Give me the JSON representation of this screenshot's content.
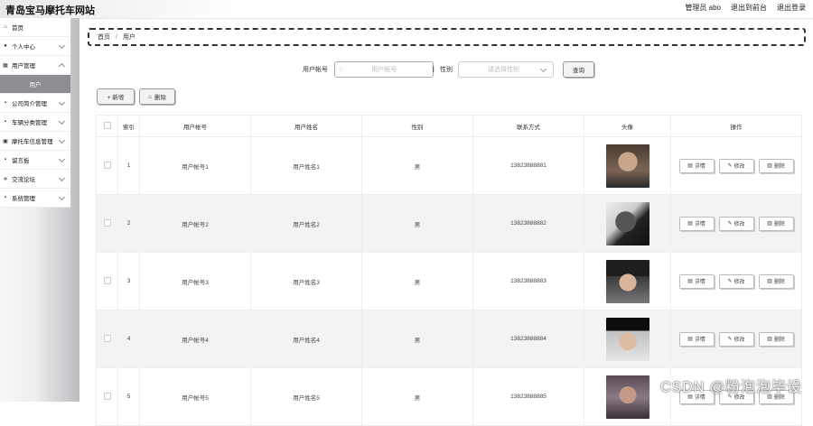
{
  "brand": "青岛宝马摩托车网站",
  "top_links": {
    "user": "管理员 abo",
    "front": "退出到前台",
    "logout": "退出登录"
  },
  "sidebar": {
    "items": [
      {
        "label": "首页",
        "icon": "home-icon"
      },
      {
        "label": "个人中心",
        "icon": "person-icon"
      },
      {
        "label": "用户管理",
        "icon": "grid-icon"
      },
      {
        "label": "用户",
        "icon": ""
      },
      {
        "label": "公司简介管理",
        "icon": "grid-icon"
      },
      {
        "label": "车辆分类管理",
        "icon": "grid-icon"
      },
      {
        "label": "摩托车信息管理",
        "icon": "archive-icon"
      },
      {
        "label": "留言板",
        "icon": "grid-icon"
      },
      {
        "label": "交流论坛",
        "icon": "sliders-icon"
      },
      {
        "label": "系统管理",
        "icon": "grid-icon"
      }
    ]
  },
  "breadcrumb": {
    "home": "首页",
    "sep": "/",
    "current": "用户"
  },
  "search": {
    "account_label": "用户帐号",
    "account_placeholder": "用户帐号",
    "gender_label": "性别",
    "gender_placeholder": "请选择性别",
    "query_button": "查询"
  },
  "actions": {
    "add": "+ 新增",
    "delete": "删除"
  },
  "table": {
    "headers": [
      "",
      "索引",
      "用户帐号",
      "用户姓名",
      "性别",
      "联系方式",
      "头像",
      "操作"
    ],
    "rows": [
      {
        "index": "1",
        "account": "用户帐号1",
        "name": "用户姓名1",
        "gender": "男",
        "phone": "13823888881"
      },
      {
        "index": "2",
        "account": "用户帐号2",
        "name": "用户姓名2",
        "gender": "男",
        "phone": "13823888882"
      },
      {
        "index": "3",
        "account": "用户帐号3",
        "name": "用户姓名3",
        "gender": "男",
        "phone": "13823888883"
      },
      {
        "index": "4",
        "account": "用户帐号4",
        "name": "用户姓名4",
        "gender": "男",
        "phone": "13823888884"
      },
      {
        "index": "5",
        "account": "用户帐号5",
        "name": "用户姓名5",
        "gender": "男",
        "phone": "13823888885"
      }
    ],
    "row_buttons": {
      "detail": "详情",
      "edit": "修改",
      "delete": "删除"
    }
  },
  "watermark": "CSDN @粉泡泡毕设"
}
